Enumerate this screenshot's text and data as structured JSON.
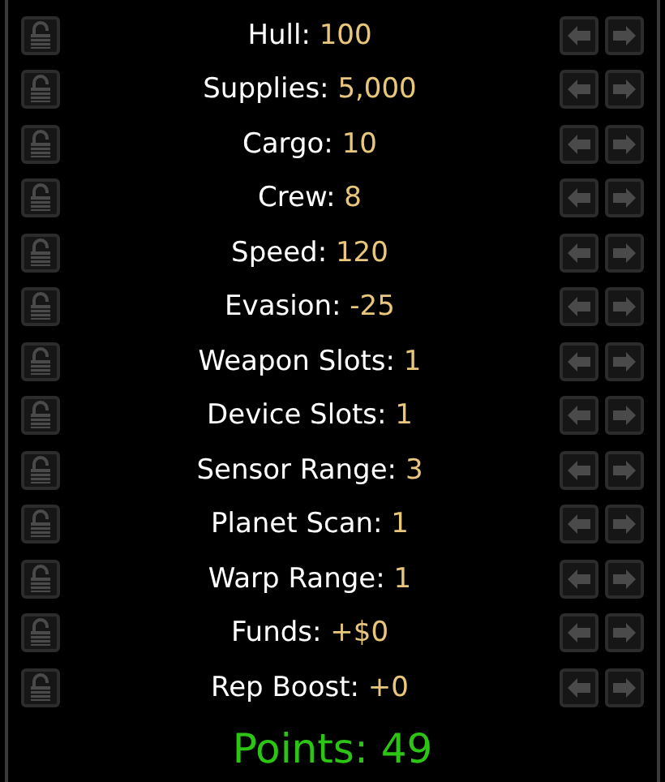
{
  "stats": [
    {
      "label": "Hull:",
      "value": "100",
      "locked": false
    },
    {
      "label": "Supplies:",
      "value": "5,000",
      "locked": false
    },
    {
      "label": "Cargo:",
      "value": "10",
      "locked": false
    },
    {
      "label": "Crew:",
      "value": "8",
      "locked": false
    },
    {
      "label": "Speed:",
      "value": "120",
      "locked": false
    },
    {
      "label": "Evasion:",
      "value": "-25",
      "locked": false
    },
    {
      "label": "Weapon Slots:",
      "value": "1",
      "locked": false
    },
    {
      "label": "Device Slots:",
      "value": "1",
      "locked": false
    },
    {
      "label": "Sensor Range:",
      "value": "3",
      "locked": false
    },
    {
      "label": "Planet Scan:",
      "value": "1",
      "locked": false
    },
    {
      "label": "Warp Range:",
      "value": "1",
      "locked": false
    },
    {
      "label": "Funds:",
      "value": "+$0",
      "locked": false
    },
    {
      "label": "Rep Boost:",
      "value": "+0",
      "locked": false
    }
  ],
  "points": "Points: 49"
}
